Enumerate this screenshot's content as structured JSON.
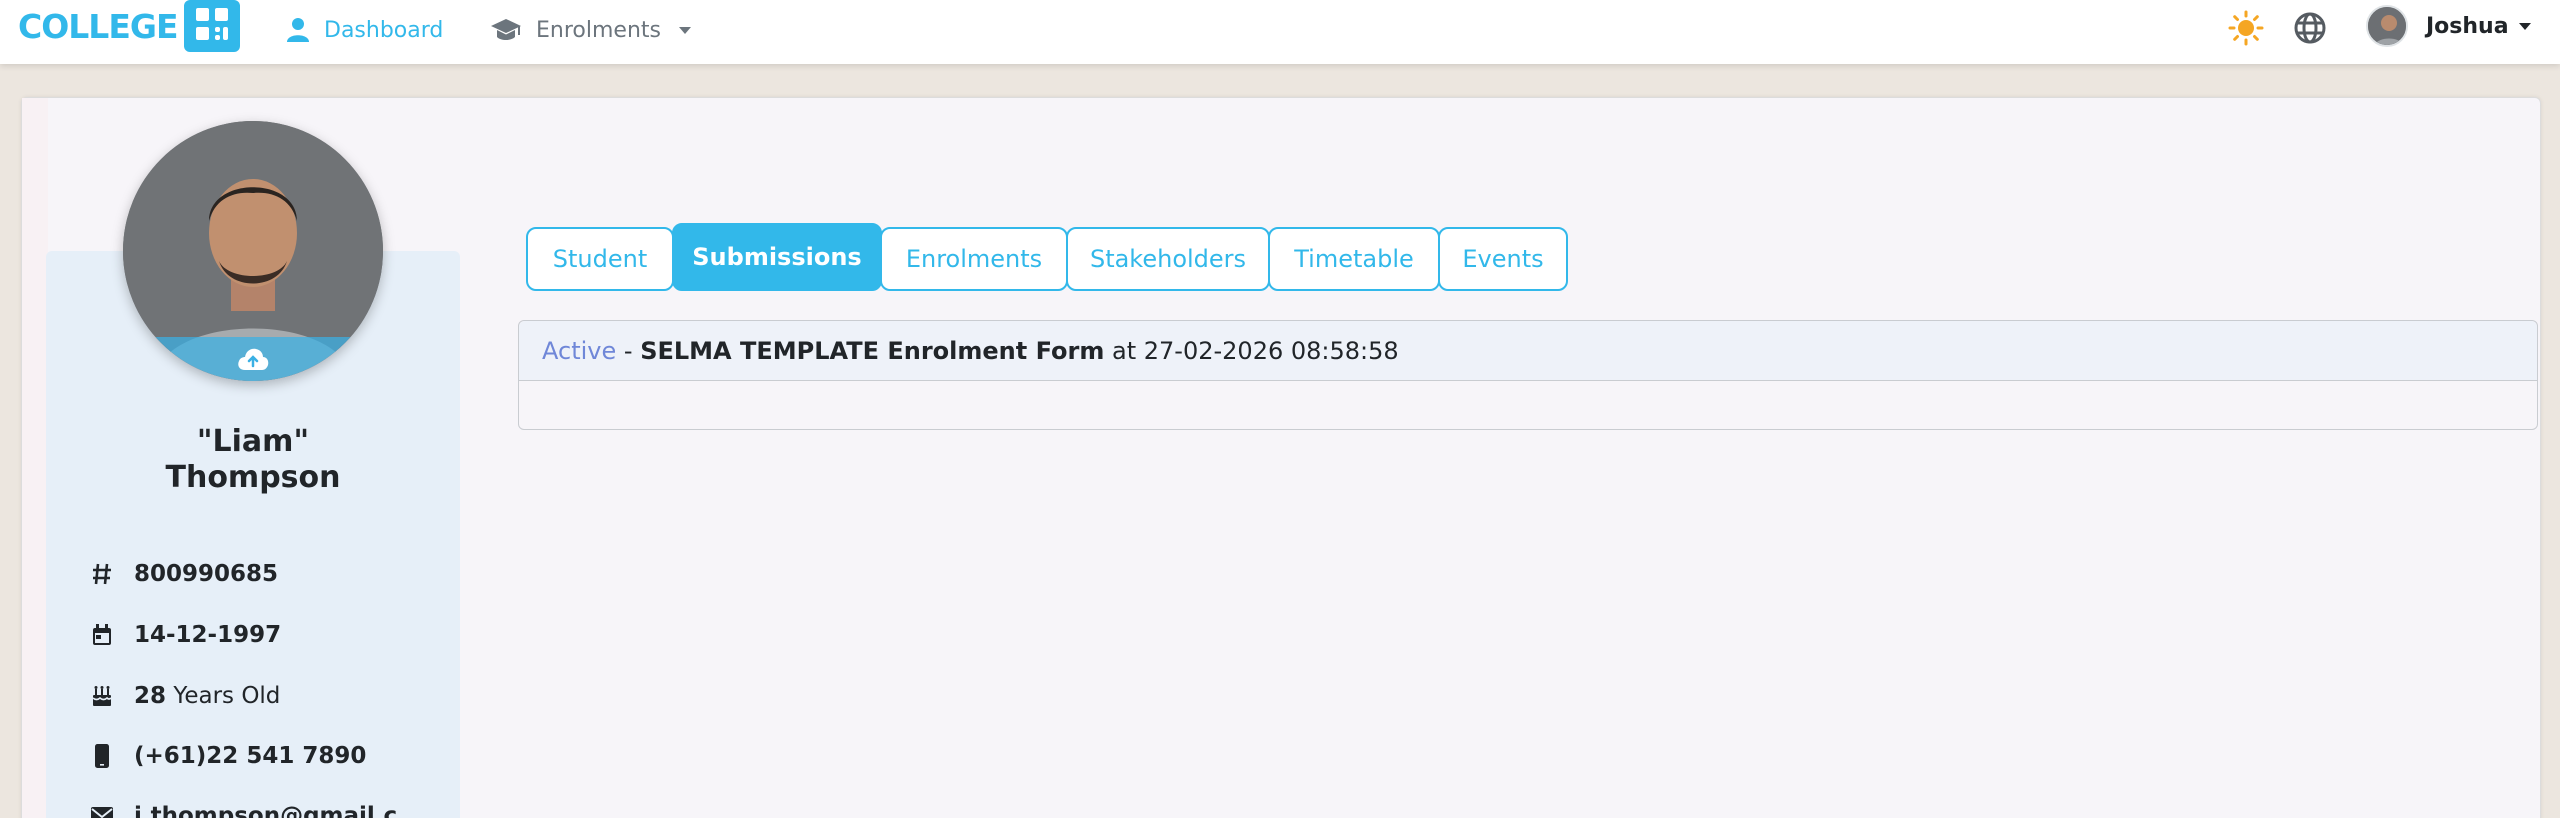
{
  "brand": {
    "name": "COLLEGE",
    "color": "#32b8ea"
  },
  "nav": {
    "dashboard_label": "Dashboard",
    "dashboard_icon": "user-icon",
    "enrolments_label": "Enrolments",
    "enrolments_icon": "graduation-cap-icon",
    "theme_icon": "sun-icon",
    "language_icon": "globe-icon",
    "user_name": "Joshua"
  },
  "tabs": [
    {
      "label": "Student",
      "active": false
    },
    {
      "label": "Submissions",
      "active": true
    },
    {
      "label": "Enrolments",
      "active": false
    },
    {
      "label": "Stakeholders",
      "active": false
    },
    {
      "label": "Timetable",
      "active": false
    },
    {
      "label": "Events",
      "active": false
    }
  ],
  "submission": {
    "status": "Active",
    "separator": "-",
    "form_name": "SELMA TEMPLATE Enrolment Form",
    "at_label": "at",
    "datetime": "27-02-2026 08:58:58"
  },
  "student": {
    "nickname": "\"Liam\"",
    "surname": "Thompson",
    "id": "800990685",
    "dob": "14-12-1997",
    "age": "28",
    "age_suffix": "Years Old",
    "phone": "(+61)22 541 7890",
    "email": "j.thompson@gmail.c"
  },
  "colors": {
    "accent": "#32b8ea",
    "status_active": "#6f87d8",
    "panel_bg": "#e6eff8"
  }
}
